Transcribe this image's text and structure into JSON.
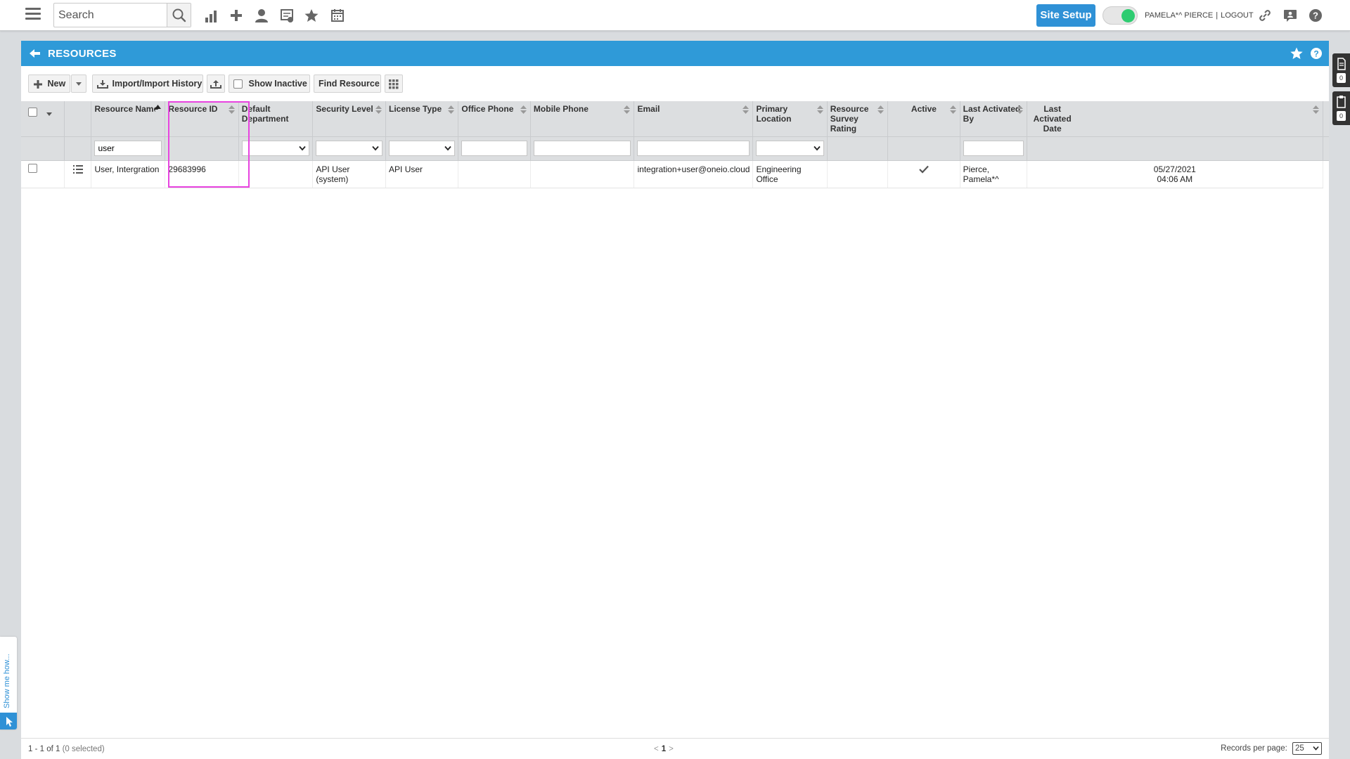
{
  "topbar": {
    "search_placeholder": "Search",
    "site_setup_label": "Site Setup",
    "user_name": "PAMELA*^ PIERCE",
    "separator": "|",
    "logout_label": "LOGOUT",
    "accent_color": "#2f91d6",
    "toggle_color": "#2ecc71"
  },
  "panel": {
    "title": "RESOURCES",
    "header_color": "#2f9ad8"
  },
  "toolbar": {
    "new_label": "New",
    "import_label": "Import/Import History",
    "show_inactive_label": "Show Inactive",
    "find_resource_label": "Find Resource"
  },
  "grid": {
    "columns": [
      "Resource Name",
      "Resource ID",
      "Default Department",
      "Security Level",
      "License Type",
      "Office Phone",
      "Mobile Phone",
      "Email",
      "Primary Location",
      "Resource Survey Rating",
      "Active",
      "Last Activated By",
      "Last Activated Date"
    ],
    "filters": {
      "resource_name": "user"
    },
    "rows": [
      {
        "resource_name": "User, Intergration",
        "resource_id": "29683996",
        "default_department": "",
        "security_level": "API User (system)",
        "license_type": "API User",
        "office_phone": "",
        "mobile_phone": "",
        "email": "integration+user@oneio.cloud",
        "primary_location": "Engineering Office",
        "survey_rating": "",
        "active": true,
        "last_activated_by": "Pierce, Pamela*^",
        "last_activated_date": "05/27/2021",
        "last_activated_time": "04:06 AM"
      }
    ]
  },
  "side_tabs": {
    "tab1_count": "0",
    "tab2_count": "0"
  },
  "show_me": {
    "label": "Show me how..."
  },
  "footer": {
    "range": "1 - 1 of 1",
    "selected": "(0 selected)",
    "prev": "<",
    "current_page": "1",
    "next": ">",
    "records_label": "Records per page:",
    "records_value": "25"
  }
}
